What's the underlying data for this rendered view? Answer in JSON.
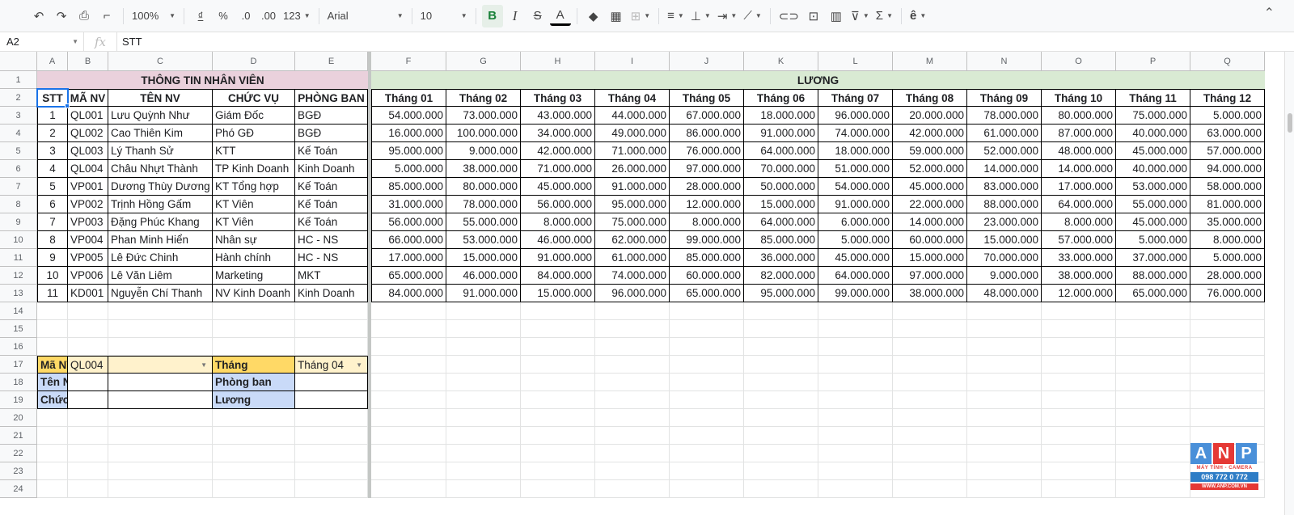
{
  "toolbar": {
    "zoom": "100%",
    "currency": "₫",
    "percent": "%",
    "dec_less": ".0",
    "dec_more": ".00",
    "format_more": "123",
    "font": "Arial",
    "font_size": "10",
    "bold": "B",
    "italic": "I",
    "strike": "S",
    "text_color": "A"
  },
  "formula_bar": {
    "cell_ref": "A2",
    "fx": "fx",
    "value": "STT"
  },
  "columns": [
    "A",
    "B",
    "C",
    "D",
    "E",
    "F",
    "G",
    "H",
    "I",
    "J",
    "K",
    "L",
    "M",
    "N",
    "O",
    "P",
    "Q"
  ],
  "rows": [
    "1",
    "2",
    "3",
    "4",
    "5",
    "6",
    "7",
    "8",
    "9",
    "10",
    "11",
    "12",
    "13",
    "14",
    "15",
    "16",
    "17",
    "18",
    "19",
    "20",
    "21",
    "22",
    "23",
    "24"
  ],
  "section_titles": {
    "employee_info": "THÔNG TIN NHÂN VIÊN",
    "salary": "LƯƠNG"
  },
  "headers": [
    "STT",
    "MÃ NV",
    "TÊN NV",
    "CHỨC VỤ",
    "PHÒNG BAN",
    "Tháng 01",
    "Tháng 02",
    "Tháng 03",
    "Tháng 04",
    "Tháng 05",
    "Tháng 06",
    "Tháng 07",
    "Tháng 08",
    "Tháng 09",
    "Tháng 10",
    "Tháng 11",
    "Tháng 12"
  ],
  "employees": [
    [
      "1",
      "QL001",
      "Lưu Quỳnh Như",
      "Giám Đốc",
      "BGĐ",
      "54.000.000",
      "73.000.000",
      "43.000.000",
      "44.000.000",
      "67.000.000",
      "18.000.000",
      "96.000.000",
      "20.000.000",
      "78.000.000",
      "80.000.000",
      "75.000.000",
      "5.000.000"
    ],
    [
      "2",
      "QL002",
      "Cao Thiên Kim",
      "Phó GĐ",
      "BGĐ",
      "16.000.000",
      "100.000.000",
      "34.000.000",
      "49.000.000",
      "86.000.000",
      "91.000.000",
      "74.000.000",
      "42.000.000",
      "61.000.000",
      "87.000.000",
      "40.000.000",
      "63.000.000"
    ],
    [
      "3",
      "QL003",
      "Lý Thanh Sử",
      "KTT",
      "Kế Toán",
      "95.000.000",
      "9.000.000",
      "42.000.000",
      "71.000.000",
      "76.000.000",
      "64.000.000",
      "18.000.000",
      "59.000.000",
      "52.000.000",
      "48.000.000",
      "45.000.000",
      "57.000.000"
    ],
    [
      "4",
      "QL004",
      "Châu Nhựt Thành",
      "TP Kinh Doanh",
      "Kinh Doanh",
      "5.000.000",
      "38.000.000",
      "71.000.000",
      "26.000.000",
      "97.000.000",
      "70.000.000",
      "51.000.000",
      "52.000.000",
      "14.000.000",
      "14.000.000",
      "40.000.000",
      "94.000.000"
    ],
    [
      "5",
      "VP001",
      "Dương Thùy Dương",
      "KT Tổng hợp",
      "Kế Toán",
      "85.000.000",
      "80.000.000",
      "45.000.000",
      "91.000.000",
      "28.000.000",
      "50.000.000",
      "54.000.000",
      "45.000.000",
      "83.000.000",
      "17.000.000",
      "53.000.000",
      "58.000.000"
    ],
    [
      "6",
      "VP002",
      "Trịnh Hồng Gấm",
      "KT Viên",
      "Kế Toán",
      "31.000.000",
      "78.000.000",
      "56.000.000",
      "95.000.000",
      "12.000.000",
      "15.000.000",
      "91.000.000",
      "22.000.000",
      "88.000.000",
      "64.000.000",
      "55.000.000",
      "81.000.000"
    ],
    [
      "7",
      "VP003",
      "Đặng Phúc Khang",
      "KT Viên",
      "Kế Toán",
      "56.000.000",
      "55.000.000",
      "8.000.000",
      "75.000.000",
      "8.000.000",
      "64.000.000",
      "6.000.000",
      "14.000.000",
      "23.000.000",
      "8.000.000",
      "45.000.000",
      "35.000.000"
    ],
    [
      "8",
      "VP004",
      "Phan Minh Hiển",
      "Nhân sự",
      "HC - NS",
      "66.000.000",
      "53.000.000",
      "46.000.000",
      "62.000.000",
      "99.000.000",
      "85.000.000",
      "5.000.000",
      "60.000.000",
      "15.000.000",
      "57.000.000",
      "5.000.000",
      "8.000.000"
    ],
    [
      "9",
      "VP005",
      "Lê Đức Chinh",
      "Hành chính",
      "HC - NS",
      "17.000.000",
      "15.000.000",
      "91.000.000",
      "61.000.000",
      "85.000.000",
      "36.000.000",
      "45.000.000",
      "15.000.000",
      "70.000.000",
      "33.000.000",
      "37.000.000",
      "5.000.000"
    ],
    [
      "10",
      "VP006",
      "Lê Văn Liêm",
      "Marketing",
      "MKT",
      "65.000.000",
      "46.000.000",
      "84.000.000",
      "74.000.000",
      "60.000.000",
      "82.000.000",
      "64.000.000",
      "97.000.000",
      "9.000.000",
      "38.000.000",
      "88.000.000",
      "28.000.000"
    ],
    [
      "11",
      "KD001",
      "Nguyễn Chí Thanh",
      "NV Kinh Doanh",
      "Kinh Doanh",
      "84.000.000",
      "91.000.000",
      "15.000.000",
      "96.000.000",
      "65.000.000",
      "95.000.000",
      "99.000.000",
      "38.000.000",
      "48.000.000",
      "12.000.000",
      "65.000.000",
      "76.000.000"
    ]
  ],
  "lookup": {
    "ma_nv_label": "Mã NV",
    "ma_nv_value": "QL004",
    "thang_label": "Tháng",
    "thang_value": "Tháng 04",
    "ten_nv_label": "Tên NV",
    "phong_ban_label": "Phòng ban",
    "chuc_vu_label": "Chức vụ",
    "luong_label": "Lương"
  },
  "watermark": {
    "letters": [
      "A",
      "N",
      "P"
    ],
    "tagline": "MÁY TÍNH - CAMERA",
    "phone": "098 772 0 772",
    "web": "WWW.ANP.COM.VN"
  },
  "colors": {
    "info_header": "#ead1dc",
    "salary_header": "#d9ead3",
    "lookup_key": "#ffd966",
    "lookup_key_light": "#fff2cc",
    "lookup_label": "#c9daf8",
    "selection": "#1a73e8"
  }
}
